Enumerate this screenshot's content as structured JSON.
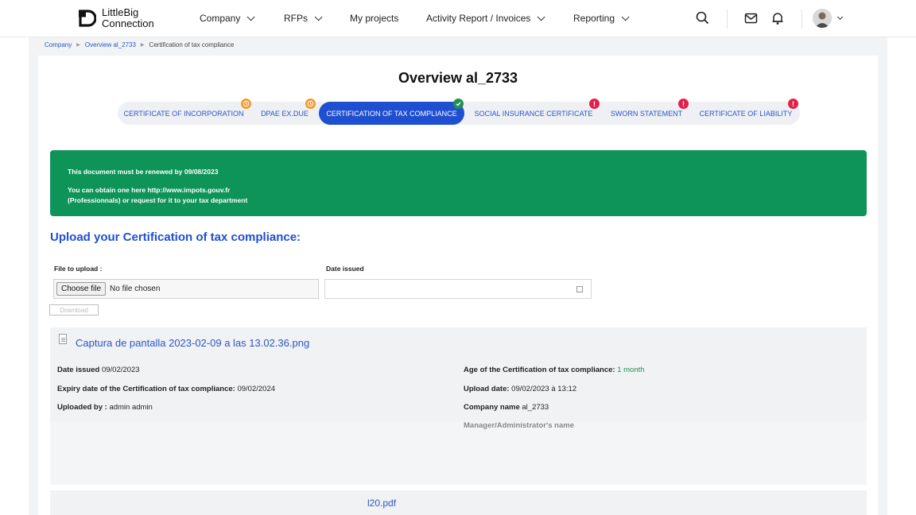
{
  "brand": {
    "name_line1": "LittleBig",
    "name_line2": "Connection"
  },
  "nav": [
    {
      "label": "Company",
      "has_menu": true
    },
    {
      "label": "RFPs",
      "has_menu": true
    },
    {
      "label": "My projects",
      "has_menu": false
    },
    {
      "label": "Activity Report / Invoices",
      "has_menu": true
    },
    {
      "label": "Reporting",
      "has_menu": true
    }
  ],
  "header_icons": [
    "search-icon",
    "mail-icon",
    "bell-icon",
    "avatar"
  ],
  "breadcrumb": [
    "Company",
    "Overview al_2733",
    "Certification of tax compliance"
  ],
  "page_title": "Overview al_2733",
  "tabs": [
    {
      "label": "CERTIFICATE OF INCORPORATION",
      "status": "pending",
      "active": false
    },
    {
      "label": "DPAE EX.DUE",
      "status": "pending",
      "active": false
    },
    {
      "label": "CERTIFICATION OF TAX COMPLIANCE",
      "status": "valid",
      "active": true
    },
    {
      "label": "SOCIAL INSURANCE CERTIFICATE",
      "status": "missing",
      "active": false
    },
    {
      "label": "SWORN STATEMENT",
      "status": "missing",
      "active": false
    },
    {
      "label": "CERTIFICATE OF LIABILITY",
      "status": "missing",
      "active": false
    }
  ],
  "colors": {
    "accent": "#1f4fd1",
    "notice_bg": "#0e9458",
    "pending": "#f39a2b",
    "valid": "#1f9152",
    "missing": "#e3204a"
  },
  "notice": {
    "line1": "This document must be renewed by 09/08/2023",
    "line2": "You can obtain one here http://www.impots.gouv.fr",
    "line3": "(Professionnals) or request for it to your tax department"
  },
  "upload": {
    "heading": "Upload your Certification of tax compliance:",
    "file_label": "File to upload :",
    "choose_button": "Choose file",
    "no_file": "No file chosen",
    "date_label": "Date issued",
    "date_value": "",
    "download_button": "Download"
  },
  "document": {
    "filename": "Captura de pantalla 2023-02-09 a las 13.02.36.png",
    "date_issued_label": "Date issued",
    "date_issued": "09/02/2023",
    "expiry_label": "Expiry date of the Certification of tax compliance:",
    "expiry": "09/02/2024",
    "uploaded_by_label": "Uploaded by :",
    "uploaded_by": "admin admin",
    "age_label": "Age of the Certification of tax compliance:",
    "age": "1 month",
    "upload_date_label": "Upload date:",
    "upload_date": "09/02/2023 à 13:12",
    "company_label": "Company name",
    "company": "al_2733",
    "manager_label": "Manager/Administrator's name"
  },
  "next_document": {
    "filename_fragment": "l20.pdf"
  }
}
